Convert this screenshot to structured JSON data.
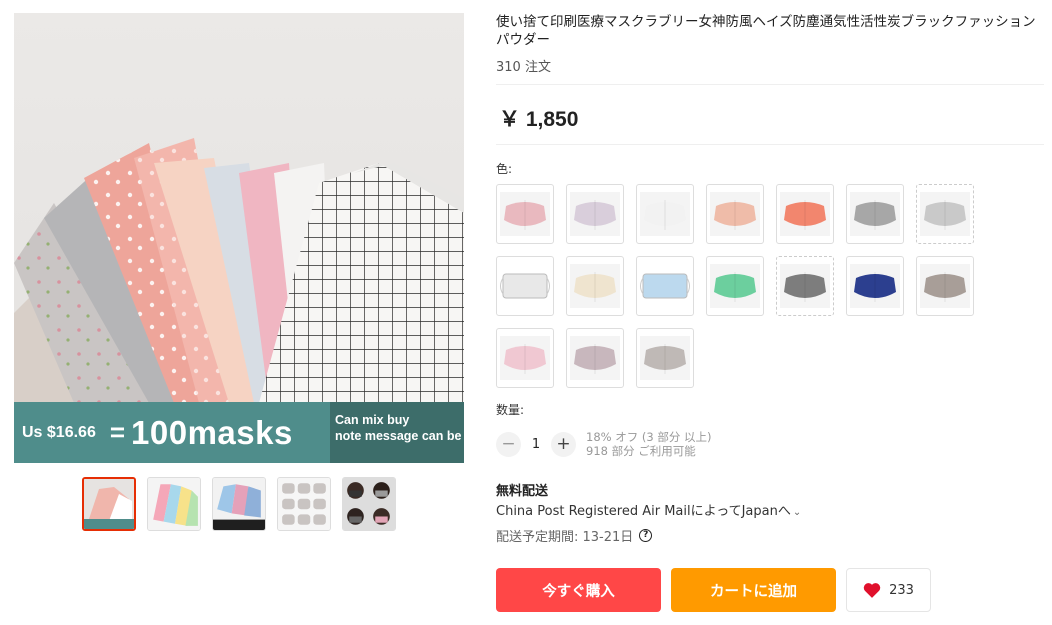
{
  "gallery": {
    "promo_price": "Us $16.66",
    "promo_eq": "=",
    "promo_qty": "100masks",
    "promo_note_1": "Can mix buy",
    "promo_note_2": "note message can be",
    "thumbnails": [
      "thumb-1",
      "thumb-2",
      "thumb-3",
      "thumb-4",
      "thumb-5"
    ]
  },
  "product": {
    "title": "使い捨て印刷医療マスクラブリー女神防風ヘイズ防塵通気性活性炭ブラックファッションパウダー",
    "orders": "310 注文",
    "price": "￥ 1,850"
  },
  "colors": {
    "label": "色:",
    "swatches": [
      {
        "name": "pink-floral",
        "c": "#e9b9bf"
      },
      {
        "name": "lilac",
        "c": "#d9cedb"
      },
      {
        "name": "white",
        "c": "#f2f2f2"
      },
      {
        "name": "peach",
        "c": "#efbca9"
      },
      {
        "name": "coral",
        "c": "#f2866e"
      },
      {
        "name": "grey",
        "c": "#a7a7a7"
      },
      {
        "name": "grey-grid",
        "c": "#c9c9c9"
      },
      {
        "name": "white-flat",
        "c": "#e8e8e8"
      },
      {
        "name": "cream",
        "c": "#efe4cf"
      },
      {
        "name": "blue-print",
        "c": "#bcd9ee"
      },
      {
        "name": "mint",
        "c": "#6ccf9e"
      },
      {
        "name": "dark-grey",
        "c": "#7d7d7d"
      },
      {
        "name": "navy-floral",
        "c": "#2c3f8f"
      },
      {
        "name": "taupe-dots",
        "c": "#a89e98"
      },
      {
        "name": "pink-dots",
        "c": "#f0c8d2"
      },
      {
        "name": "mauve",
        "c": "#c8b7bd"
      },
      {
        "name": "stone",
        "c": "#bfb9b6"
      }
    ]
  },
  "quantity": {
    "label": "数量:",
    "minus": "−",
    "value": "1",
    "plus": "+",
    "discount": "18% オフ (3 部分 以上)",
    "available": "918 部分 ご利用可能"
  },
  "shipping": {
    "title": "無料配送",
    "method": "China Post Registered Air MailによってJapanへ",
    "chevron": "⌄",
    "time": "配送予定期間: 13-21日",
    "help": "?"
  },
  "actions": {
    "buy_now": "今すぐ購入",
    "add_to_cart": "カートに追加",
    "wish_count": "233"
  },
  "colors_theme": {
    "accent_red": "#ff4747",
    "accent_orange": "#ff9a00",
    "promo_teal": "#4f8d8b"
  }
}
